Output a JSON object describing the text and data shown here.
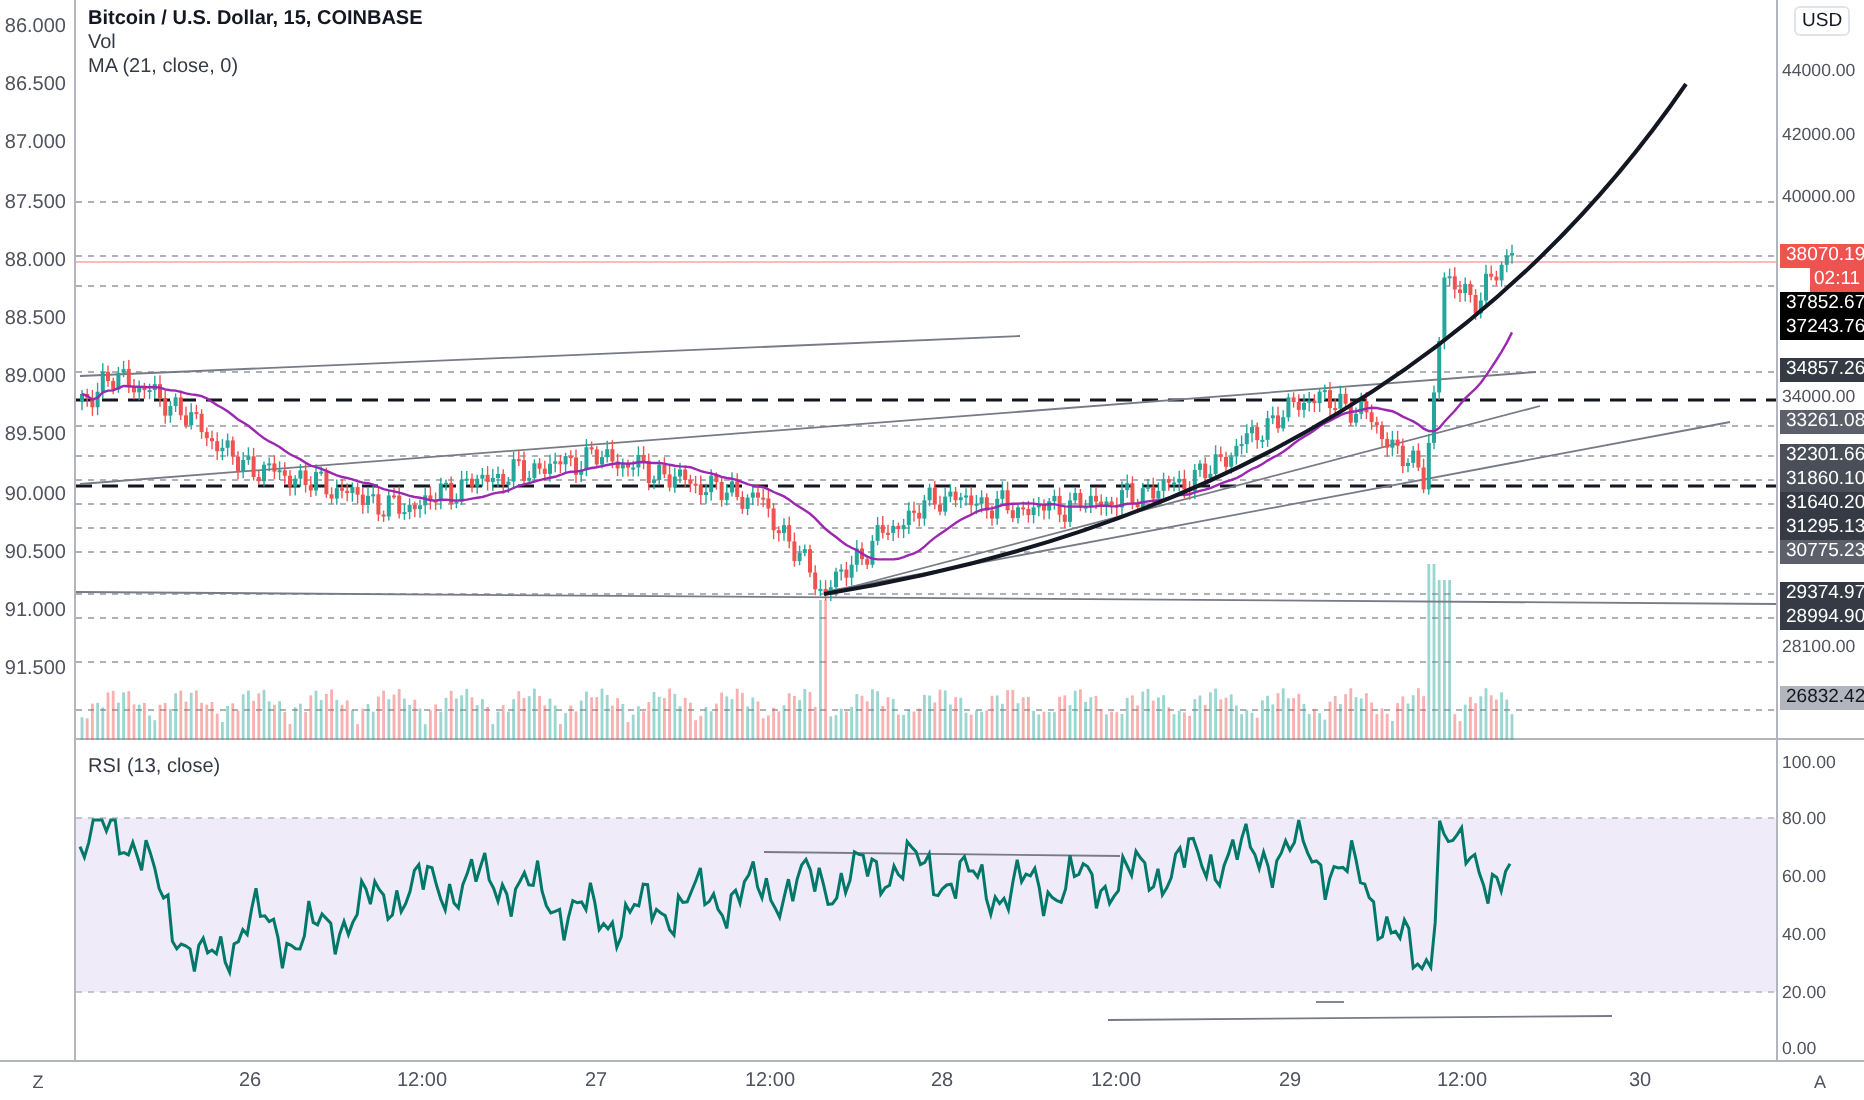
{
  "legend": {
    "title": "Bitcoin / U.S. Dollar, 15, COINBASE",
    "indicators": [
      "Vol",
      "MA (21, close, 0)"
    ]
  },
  "left_axis": {
    "labels": [
      "86.000",
      "86.500",
      "87.000",
      "87.500",
      "88.000",
      "88.500",
      "89.000",
      "89.500",
      "90.000",
      "90.500",
      "91.000",
      "91.500"
    ]
  },
  "right_axis": {
    "currency_button": "USD",
    "ticks": [
      "44000.00",
      "42000.00",
      "40000.00",
      "34000.00",
      "28100.00"
    ],
    "price_tags": [
      {
        "text": "38070.19",
        "kind": "price",
        "color": "#ef5350"
      },
      {
        "text": "02:11",
        "kind": "countdown",
        "color": "#ef5350"
      },
      {
        "text": "37852.67",
        "kind": "price",
        "color": "#000000"
      },
      {
        "text": "37243.76",
        "kind": "price",
        "color": "#000000"
      },
      {
        "text": "34857.26",
        "kind": "price",
        "color": "#363a45"
      },
      {
        "text": "33261.08",
        "kind": "price",
        "color": "#5d606b"
      },
      {
        "text": "32301.66",
        "kind": "price",
        "color": "#4a4e59"
      },
      {
        "text": "31860.10",
        "kind": "price",
        "color": "#4a4e59"
      },
      {
        "text": "31640.20",
        "kind": "price",
        "color": "#363a45"
      },
      {
        "text": "31295.13",
        "kind": "price",
        "color": "#363a45"
      },
      {
        "text": "30775.23",
        "kind": "price",
        "color": "#5d606b"
      },
      {
        "text": "29374.97",
        "kind": "price",
        "color": "#363a45"
      },
      {
        "text": "28994.90",
        "kind": "price",
        "color": "#363a45"
      },
      {
        "text": "26832.42",
        "kind": "price",
        "color": "#b2b5be"
      }
    ]
  },
  "rsi": {
    "title": "RSI (13, close)",
    "ticks": [
      "100.00",
      "80.00",
      "60.00",
      "40.00",
      "20.00",
      "0.00"
    ]
  },
  "time_axis": {
    "labels": [
      "26",
      "12:00",
      "27",
      "12:00",
      "28",
      "12:00",
      "29",
      "12:00",
      "30"
    ],
    "left_button": "Z",
    "right_button": "A"
  }
}
